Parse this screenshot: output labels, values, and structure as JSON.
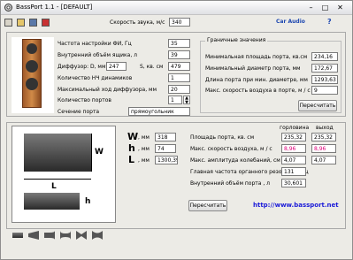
{
  "window": {
    "title": "BassPort 1.1 - [DEFAULT]",
    "min": "–",
    "max": "□",
    "close": "✕"
  },
  "toolbar": {
    "icons": [
      "home-icon",
      "open-folder-icon",
      "save-icon",
      "close-red-icon"
    ]
  },
  "speed": {
    "label": "Скорость звука, м/с",
    "value": "340"
  },
  "menu": {
    "car_audio": "Car Audio",
    "help": "?"
  },
  "params": [
    {
      "label": "Частота настройки ФИ, Гц",
      "value": "35"
    },
    {
      "label": "Внутренний объём ящика, л",
      "value": "39"
    },
    {
      "label": "Диффузор: D, мм",
      "value": "247",
      "s_label": "S, кв. см",
      "s_value": "479"
    },
    {
      "label": "Количество НЧ динамиков",
      "value": "1"
    },
    {
      "label": "Максимальный ход диффузора, мм",
      "value": "20"
    },
    {
      "label": "Количество портов",
      "value": "1"
    },
    {
      "label": "Сечение порта",
      "value": "прямоугольник"
    }
  ],
  "limits": {
    "title": "Граничные значения",
    "rows": [
      {
        "label": "Минимальная площадь порта, кв.см",
        "value": "234,16"
      },
      {
        "label": "Минимальный диаметр порта, мм",
        "value": "172,67"
      },
      {
        "label": "Длина порта при мин. диаметре, мм",
        "value": "1293,63"
      },
      {
        "label": "Макс. скорость воздуха в порте, м / с",
        "value": "9"
      }
    ],
    "button": "Пересчитать"
  },
  "dims": {
    "W": {
      "label": "W",
      "unit": ", мм",
      "value": "318"
    },
    "h": {
      "label": "h",
      "unit": ", мм",
      "value": "74"
    },
    "L": {
      "label": "L",
      "unit": ", мм",
      "value": "1300,39"
    }
  },
  "results": {
    "col1": "горловина",
    "col2": "выход",
    "rows": [
      {
        "label": "Площадь порта, кв. см",
        "v1": "235,32",
        "v2": "235,32"
      },
      {
        "label": "Макс. скорость воздуха, м / с",
        "v1": "8,96",
        "v2": "8,96"
      },
      {
        "label": "Макс. амплитуда колебаний, см",
        "v1": "4,07",
        "v2": "4,07"
      },
      {
        "label": "Главная частота органного резонанса, Гц",
        "v1": "131"
      },
      {
        "label": "Внутренний объём порта , л",
        "v1": "30,601"
      }
    ]
  },
  "recalc_button": "Пересчитать",
  "link": "http://www.bassport.net",
  "diagram": {
    "W": "W",
    "L": "L",
    "h": "h"
  }
}
